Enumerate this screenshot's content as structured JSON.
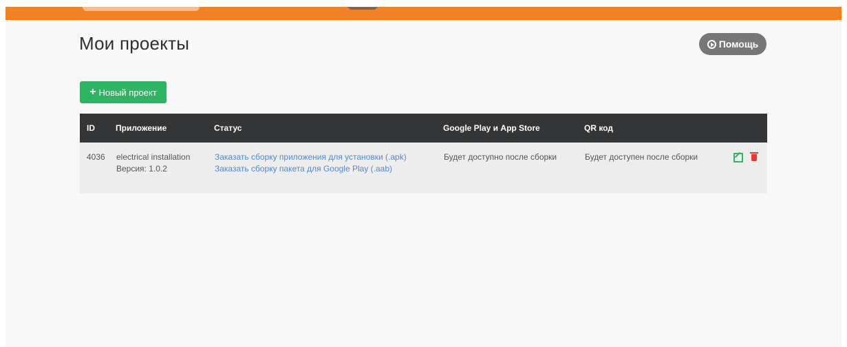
{
  "page": {
    "title": "Мои проекты",
    "help_label": "Помощь",
    "new_project_label": "Новый проект"
  },
  "table": {
    "headers": {
      "id": "ID",
      "app": "Приложение",
      "status": "Статус",
      "stores": "Google Play и App Store",
      "qr": "QR код"
    },
    "rows": [
      {
        "id": "4036",
        "app_name": "electrical installation",
        "version": "Версия: 1.0.2",
        "apk_link": "Заказать сборку приложения для установки (.apk)",
        "aab_link": "Заказать сборку пакета для Google Play (.aab)",
        "stores": "Будет доступно после сборки",
        "qr": "Будет доступен после сборки"
      }
    ]
  },
  "icons": {
    "help": "play-circle-icon",
    "new_project": "plus-icon",
    "edit": "edit-icon",
    "delete": "trash-icon"
  },
  "colors": {
    "header_bar": "#f48222",
    "help_button": "#777777",
    "new_project_button": "#2fb562",
    "table_header": "#333536",
    "link": "#4f8ad1",
    "delete": "#e53935"
  }
}
